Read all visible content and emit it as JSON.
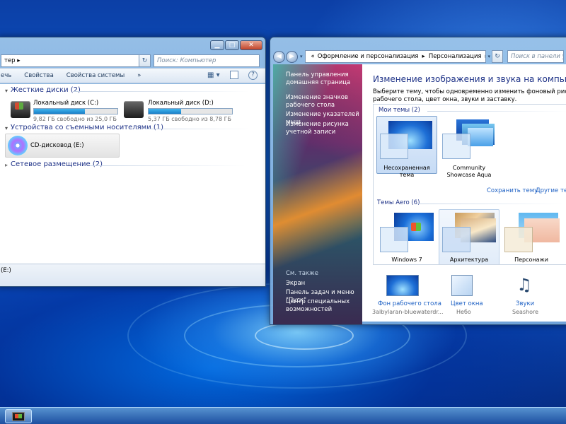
{
  "explorer": {
    "address": "тер ▸",
    "search_placeholder": "Поиск: Компьютер",
    "toolbar": [
      "ечь",
      "Свойства",
      "Свойства системы",
      "»"
    ],
    "groups": {
      "hard_disks": "Жесткие диски (2)",
      "removable": "Устройства со съемными носителями (1)",
      "network": "Сетевое размещение (2)"
    },
    "drives": [
      {
        "name": "Локальный диск (C:)",
        "free": "9,82 ГБ свободно из 25,0 ГБ",
        "used_fraction": 0.61
      },
      {
        "name": "Локальный диск (D:)",
        "free": "5,37 ГБ свободно из 8,78 ГБ",
        "used_fraction": 0.39
      }
    ],
    "cd": {
      "name": "CD-дисковод (E:)"
    },
    "status": "(E:)"
  },
  "personalization": {
    "breadcrumb_1": "Оформление и персонализация",
    "breadcrumb_2": "Персонализация",
    "search_placeholder": "Поиск в панели упр",
    "nav": {
      "home": "Панель управления домашняя страница",
      "icons": "Изменение значков рабочего стола",
      "pointers": "Изменение указателей мыш",
      "account": "Изменение рисунка учетной записи",
      "see_also": "См. также",
      "screen": "Экран",
      "taskbar": "Панель задач и меню \"Пуск\"",
      "ease": "Центр специальных возможностей"
    },
    "title": "Изменение изображения и звука на компьютере",
    "desc": "Выберите тему, чтобы одновременно изменить фоновый рисунок рабочего стола, цвет окна, звуки и заставку.",
    "my_themes_header": "Мои темы (2)",
    "my_themes": [
      "Несохраненная тема",
      "Community Showcase Aqua"
    ],
    "save_theme": "Сохранить тему",
    "other_themes": "Другие темы",
    "aero_header": "Темы Aero (6)",
    "aero_themes": [
      "Windows 7",
      "Архитектура",
      "Персонажи"
    ],
    "bottom": [
      {
        "label": "Фон рабочего стола",
        "sub": "3albylaran-bluewaterdr..."
      },
      {
        "label": "Цвет окна",
        "sub": "Небо"
      },
      {
        "label": "Звуки",
        "sub": "Seashore"
      }
    ]
  },
  "colors": {
    "accent": "#1e3287",
    "link": "#1e61c4",
    "bar_fill": "#1a7ec6"
  }
}
